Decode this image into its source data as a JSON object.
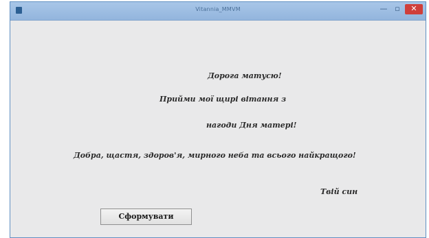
{
  "window": {
    "title": "Vitannia_MMVM",
    "minimize_glyph": "—",
    "maximize_glyph": "▫",
    "close_glyph": "✕"
  },
  "message": {
    "line1": "Дорога матусю!",
    "line2": "Прийми мої щирі вітання з",
    "line3": "нагоди Дня матері!",
    "line4": "Добра, щастя, здоров'я, мирного неба та всього найкращого!",
    "line5": "Твій син"
  },
  "buttons": {
    "form_label": "Сформувати"
  },
  "colors": {
    "titlebar": "#9dbde2",
    "background": "#e9e9ea",
    "close": "#cf3f3b",
    "text": "#2a2a2a"
  }
}
